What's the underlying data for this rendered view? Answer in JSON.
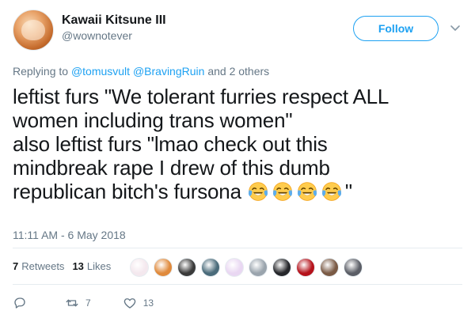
{
  "user": {
    "display_name": "Kawaii Kitsune III",
    "handle": "@wownotever",
    "avatar_icon": "fox-avatar-icon"
  },
  "follow_label": "Follow",
  "reply_to": {
    "prefix": "Replying to",
    "mention_1": "@tomusvult",
    "mention_2": "@BravingRuin",
    "suffix": "and 2 others"
  },
  "tweet": {
    "line_1": "leftist furs \"We tolerant furries respect ALL",
    "line_2": "women including trans women\"",
    "line_3": "also leftist furs \"lmao check out this",
    "line_4": "mindbreak rape I drew of this dumb",
    "line_5": "republican bitch's fursona",
    "line_5_end": "\"",
    "emoji_name": "face-with-tears-of-joy-icon",
    "emoji_count": 4
  },
  "timestamp": "11:11 AM - 6 May 2018",
  "stats": {
    "retweets_count": "7",
    "retweets_label": "Retweets",
    "likes_count": "13",
    "likes_label": "Likes"
  },
  "likers": [
    {
      "color": "#f4e8ee"
    },
    {
      "color": "#e08a3c"
    },
    {
      "color": "#3a3a3a"
    },
    {
      "color": "#4a6b7a"
    },
    {
      "color": "#e9d7f2"
    },
    {
      "color": "#9aa4ad"
    },
    {
      "color": "#26272b"
    },
    {
      "color": "#b5121b"
    },
    {
      "color": "#7a5a45"
    },
    {
      "color": "#5b5e66"
    }
  ],
  "actions": {
    "reply_count": "",
    "retweet_count": "7",
    "like_count": "13"
  },
  "colors": {
    "accent": "#1da1f2",
    "muted": "#657786",
    "text": "#14171a",
    "border": "#e6ecf0"
  }
}
